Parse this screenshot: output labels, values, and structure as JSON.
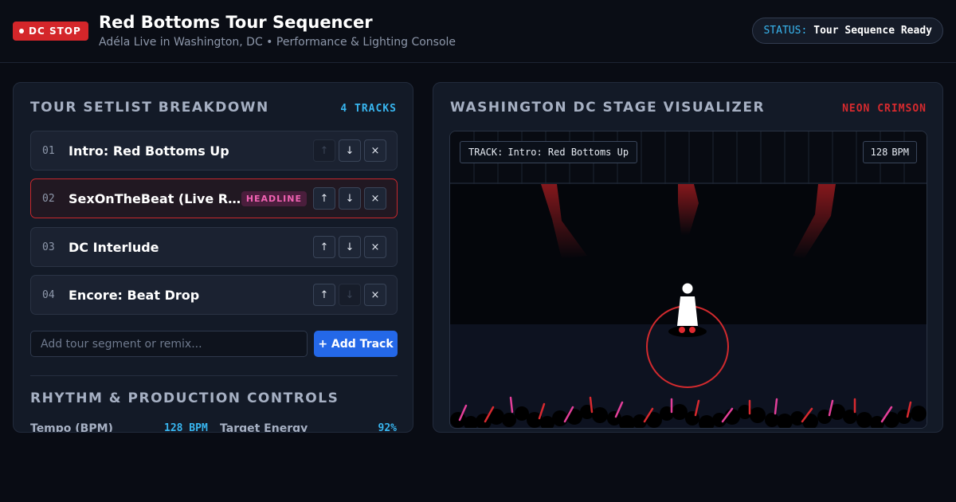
{
  "header": {
    "badge_label": "DC STOP",
    "title": "Red Bottoms Tour Sequencer",
    "subtitle": "Adéla Live in Washington, DC • Performance & Lighting Console",
    "status_key": "STATUS:",
    "status_value": "Tour Sequence Ready"
  },
  "setlist": {
    "title": "TOUR SETLIST BREAKDOWN",
    "count_label": "4 TRACKS",
    "tracks": [
      {
        "num": "01",
        "name": "Intro: Red Bottoms Up",
        "badge": ""
      },
      {
        "num": "02",
        "name": "SexOnTheBeat (Live Remix)",
        "badge": "HEADLINE"
      },
      {
        "num": "03",
        "name": "DC Interlude",
        "badge": ""
      },
      {
        "num": "04",
        "name": "Encore: Beat Drop",
        "badge": ""
      }
    ],
    "move_up_icon": "↑",
    "move_down_icon": "↓",
    "remove_icon": "×",
    "add_placeholder": "Add tour segment or remix...",
    "add_button": "+ Add Track"
  },
  "controls": {
    "title": "RHYTHM & PRODUCTION CONTROLS",
    "tempo_label": "Tempo (BPM)",
    "tempo_value": "128 BPM",
    "energy_label": "Target Energy",
    "energy_value": "92%"
  },
  "visualizer": {
    "title": "WASHINGTON DC STAGE VISUALIZER",
    "theme_label": "NEON CRIMSON",
    "track_prefix": "TRACK:",
    "track_name": "Intro: Red Bottoms Up",
    "bpm_value": "128",
    "bpm_unit": "BPM"
  },
  "colors": {
    "accent_blue": "#38b6f0",
    "accent_red": "#d62a2e",
    "primary_button": "#2468e8",
    "headline_pink": "#f062b2"
  }
}
